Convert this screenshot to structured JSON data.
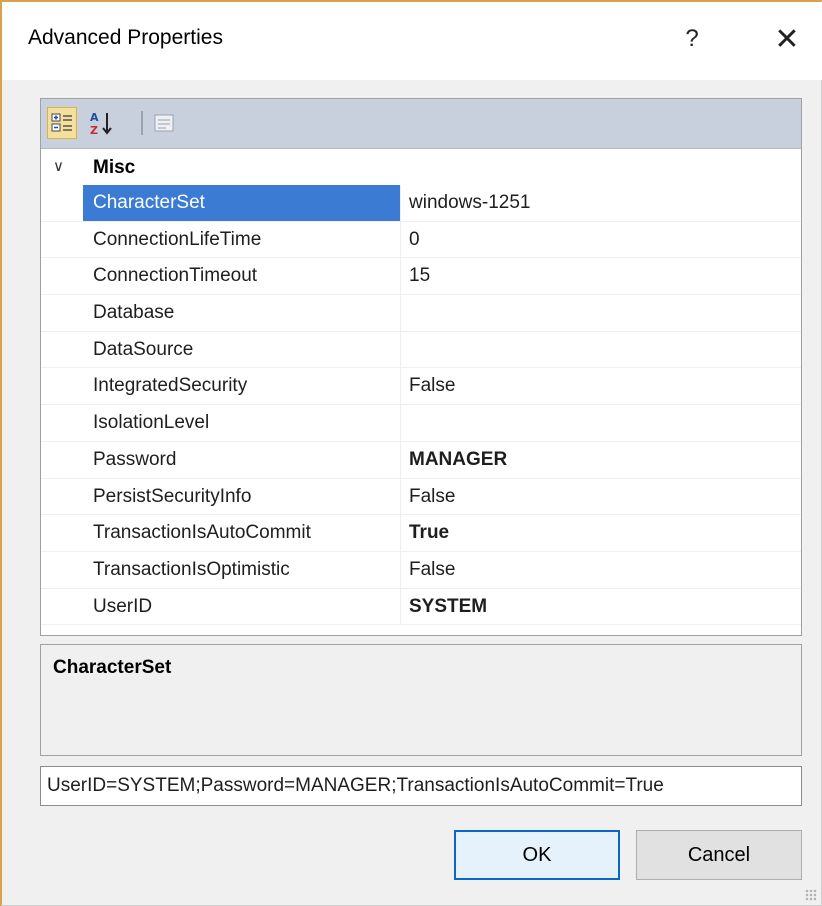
{
  "window": {
    "title": "Advanced Properties",
    "help_label": "?",
    "close_label": "✕"
  },
  "toolbar": {
    "categorized_icon": "categorized-icon",
    "alphabetical_icon": "alphabetical-sort-icon",
    "property_pages_icon": "property-pages-icon"
  },
  "grid": {
    "category": "Misc",
    "selected": "CharacterSet",
    "rows": [
      {
        "name": "CharacterSet",
        "value": "windows-1251",
        "bold": false
      },
      {
        "name": "ConnectionLifeTime",
        "value": "0",
        "bold": false
      },
      {
        "name": "ConnectionTimeout",
        "value": "15",
        "bold": false
      },
      {
        "name": "Database",
        "value": "",
        "bold": false
      },
      {
        "name": "DataSource",
        "value": "",
        "bold": false
      },
      {
        "name": "IntegratedSecurity",
        "value": "False",
        "bold": false
      },
      {
        "name": "IsolationLevel",
        "value": "",
        "bold": false
      },
      {
        "name": "Password",
        "value": "MANAGER",
        "bold": true
      },
      {
        "name": "PersistSecurityInfo",
        "value": "False",
        "bold": false
      },
      {
        "name": "TransactionIsAutoCommit",
        "value": "True",
        "bold": true
      },
      {
        "name": "TransactionIsOptimistic",
        "value": "False",
        "bold": false
      },
      {
        "name": "UserID",
        "value": "SYSTEM",
        "bold": true
      }
    ]
  },
  "description": {
    "title": "CharacterSet"
  },
  "connection_string": "UserID=SYSTEM;Password=MANAGER;TransactionIsAutoCommit=True",
  "buttons": {
    "ok": "OK",
    "cancel": "Cancel"
  },
  "colors": {
    "selection": "#3b7bd4",
    "toolbar": "#c7d0dc",
    "default_button_border": "#0a66c8"
  }
}
